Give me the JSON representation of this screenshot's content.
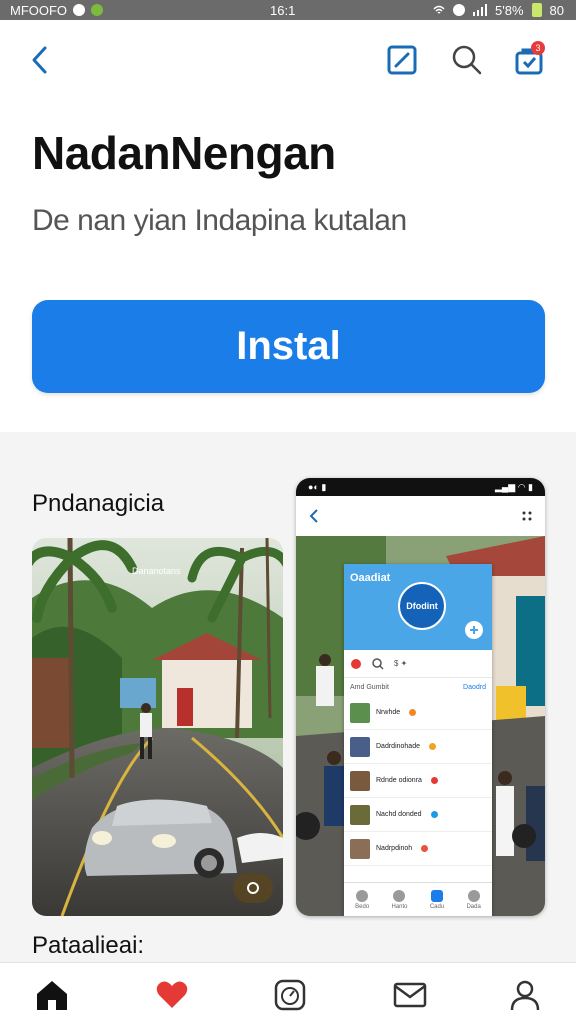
{
  "status_bar": {
    "carrier": "MFOOFO",
    "time": "16:1",
    "battery": "5'8%",
    "extra": "80"
  },
  "top_bar": {
    "cart_badge": "3"
  },
  "app": {
    "title": "NadanNengan",
    "subtitle": "De nan yian Indapina kutalan"
  },
  "install": {
    "label": "Instal"
  },
  "gallery": {
    "section_label": "Pndanagicia",
    "photo_caption": "Dananotans",
    "phone": {
      "inner_title": "Oaadiat",
      "logo_text": "Dfodint",
      "toolbar_text": "$ ✦",
      "sub_left": "Amd Gumbit",
      "sub_right": "Daodrd",
      "rows": [
        {
          "label": "Nrwhde"
        },
        {
          "label": "Dadrdinohade"
        },
        {
          "label": "Rdnde odionra"
        },
        {
          "label": "Nachd donded"
        },
        {
          "label": "Nadrpdinoh"
        }
      ],
      "tabs": [
        "Bedo",
        "Hanto",
        "Cadu",
        "Dada"
      ]
    }
  },
  "section_label_2": "Pataalieai:",
  "colors": {
    "accent": "#1a7de8",
    "icon_blue": "#1a6bb5",
    "heart_red": "#e53935"
  },
  "bottom_nav": {
    "icons": [
      "home-icon",
      "heart-icon",
      "timer-icon",
      "mail-icon",
      "profile-icon"
    ]
  }
}
